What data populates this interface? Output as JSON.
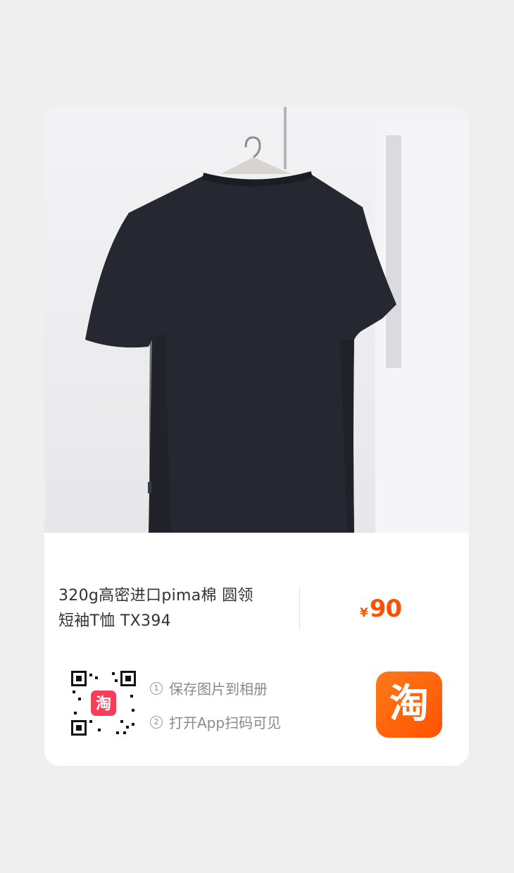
{
  "product": {
    "title_line1": "320g高密进口pima棉 圆领",
    "title_line2": "短袖T恤 TX394",
    "currency": "¥",
    "price": "90"
  },
  "share": {
    "step1_num": "1",
    "step1_text": "保存图片到相册",
    "step2_num": "2",
    "step2_text": "打开App扫码可见",
    "qr_center_logo": "淘",
    "app_logo_char": "淘"
  },
  "colors": {
    "price": "#ff5000",
    "app_logo": "#ff5a00",
    "shirt": "#24262d"
  },
  "icons": [
    "qr-code-icon",
    "taobao-app-icon"
  ]
}
